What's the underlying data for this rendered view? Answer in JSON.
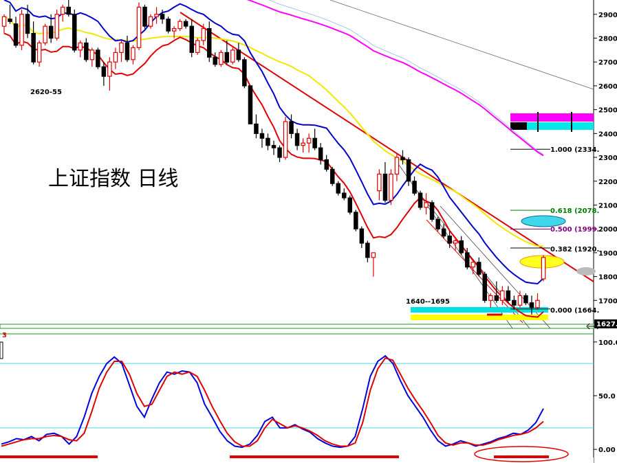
{
  "chart_data": [
    {
      "type": "candlestick",
      "title": "上证指数  日线",
      "ylim": [
        1600,
        2960
      ],
      "y_ticks": [
        "2900.-",
        "2800.-",
        "2700.-",
        "2600.-",
        "2500.-",
        "2400.-",
        "2300.-",
        "2200.-",
        "2100.-",
        "2000.-",
        "1900.-",
        "1800.-",
        "1700.-"
      ],
      "y_tick_values": [
        2900,
        2800,
        2700,
        2600,
        2500,
        2400,
        2300,
        2200,
        2100,
        2000,
        1900,
        1800,
        1700
      ],
      "last_price_label": "1627.",
      "annotations": {
        "high_label": "2620-55",
        "low_label": "1640--1695"
      },
      "fibonacci": [
        {
          "label": "1.000 (2334.",
          "value": 2334,
          "color": "#000000"
        },
        {
          "label": "0.618 (2078.",
          "value": 2078,
          "color": "#007a00"
        },
        {
          "label": "0.500 (1999.",
          "value": 1999,
          "color": "#800080"
        },
        {
          "label": "0.382 (1920.",
          "value": 1920,
          "color": "#000000"
        },
        {
          "label": "0.000 (1664.",
          "value": 1664,
          "color": "#000000"
        }
      ],
      "colors": {
        "up": "#e00000",
        "down": "#000000",
        "ma_blue": "#0000cc",
        "ma_red": "#e00000",
        "ma_yellow": "#f0e800",
        "ma_magenta": "#ff00ff",
        "ma_lightblue": "#8fb8ee",
        "trend": "#e00000",
        "zone_cyan": "#00e0e0",
        "zone_yellow": "#ffff00"
      },
      "candles": [
        [
          2850,
          2900,
          2820,
          2890
        ],
        [
          2880,
          2940,
          2860,
          2870
        ],
        [
          2860,
          2890,
          2760,
          2770
        ],
        [
          2770,
          2920,
          2750,
          2900
        ],
        [
          2900,
          2940,
          2800,
          2820
        ],
        [
          2820,
          2870,
          2690,
          2700
        ],
        [
          2700,
          2790,
          2680,
          2780
        ],
        [
          2780,
          2860,
          2770,
          2850
        ],
        [
          2850,
          2900,
          2780,
          2800
        ],
        [
          2800,
          2920,
          2790,
          2900
        ],
        [
          2900,
          2940,
          2870,
          2930
        ],
        [
          2930,
          2960,
          2890,
          2900
        ],
        [
          2900,
          2920,
          2740,
          2750
        ],
        [
          2750,
          2790,
          2720,
          2780
        ],
        [
          2780,
          2800,
          2700,
          2710
        ],
        [
          2710,
          2760,
          2680,
          2750
        ],
        [
          2750,
          2760,
          2670,
          2680
        ],
        [
          2680,
          2700,
          2600,
          2640
        ],
        [
          2640,
          2720,
          2580,
          2700
        ],
        [
          2700,
          2760,
          2670,
          2740
        ],
        [
          2740,
          2790,
          2700,
          2780
        ],
        [
          2780,
          2810,
          2700,
          2710
        ],
        [
          2710,
          2770,
          2690,
          2760
        ],
        [
          2760,
          2950,
          2750,
          2930
        ],
        [
          2930,
          2940,
          2840,
          2850
        ],
        [
          2850,
          2900,
          2840,
          2890
        ],
        [
          2890,
          2930,
          2860,
          2900
        ],
        [
          2900,
          2920,
          2860,
          2880
        ],
        [
          2880,
          2890,
          2820,
          2830
        ],
        [
          2830,
          2850,
          2800,
          2840
        ],
        [
          2840,
          2880,
          2830,
          2870
        ],
        [
          2870,
          2880,
          2840,
          2850
        ],
        [
          2850,
          2880,
          2720,
          2740
        ],
        [
          2740,
          2800,
          2730,
          2790
        ],
        [
          2790,
          2860,
          2770,
          2840
        ],
        [
          2840,
          2870,
          2700,
          2720
        ],
        [
          2720,
          2740,
          2680,
          2690
        ],
        [
          2690,
          2750,
          2680,
          2740
        ],
        [
          2740,
          2790,
          2690,
          2700
        ],
        [
          2700,
          2760,
          2690,
          2750
        ],
        [
          2750,
          2780,
          2700,
          2710
        ],
        [
          2710,
          2720,
          2590,
          2600
        ],
        [
          2600,
          2600,
          2440,
          2440
        ],
        [
          2440,
          2480,
          2380,
          2400
        ],
        [
          2400,
          2420,
          2340,
          2380
        ],
        [
          2380,
          2400,
          2330,
          2350
        ],
        [
          2350,
          2370,
          2310,
          2340
        ],
        [
          2340,
          2350,
          2280,
          2300
        ],
        [
          2300,
          2470,
          2290,
          2450
        ],
        [
          2450,
          2480,
          2380,
          2400
        ],
        [
          2400,
          2420,
          2330,
          2350
        ],
        [
          2350,
          2380,
          2320,
          2360
        ],
        [
          2360,
          2400,
          2320,
          2380
        ],
        [
          2380,
          2420,
          2330,
          2340
        ],
        [
          2340,
          2360,
          2270,
          2290
        ],
        [
          2290,
          2310,
          2240,
          2250
        ],
        [
          2250,
          2260,
          2180,
          2190
        ],
        [
          2190,
          2200,
          2140,
          2150
        ],
        [
          2150,
          2170,
          2120,
          2130
        ],
        [
          2130,
          2140,
          2060,
          2070
        ],
        [
          2070,
          2080,
          1990,
          2000
        ],
        [
          2000,
          2010,
          1920,
          1940
        ],
        [
          1940,
          1950,
          1860,
          1880
        ],
        [
          1880,
          1900,
          1800,
          1900
        ],
        [
          2160,
          2250,
          2120,
          2230
        ],
        [
          2230,
          2280,
          2110,
          2120
        ],
        [
          2120,
          2250,
          2100,
          2230
        ],
        [
          2230,
          2320,
          2200,
          2300
        ],
        [
          2300,
          2330,
          2270,
          2290
        ],
        [
          2290,
          2300,
          2180,
          2200
        ],
        [
          2200,
          2220,
          2140,
          2150
        ],
        [
          2150,
          2160,
          2080,
          2090
        ],
        [
          2090,
          2150,
          2060,
          2110
        ],
        [
          2110,
          2120,
          2030,
          2040
        ],
        [
          2040,
          2050,
          1990,
          2000
        ],
        [
          2000,
          2020,
          1960,
          1970
        ],
        [
          1970,
          1990,
          1920,
          1940
        ],
        [
          1940,
          1960,
          1910,
          1950
        ],
        [
          1950,
          1970,
          1890,
          1900
        ],
        [
          1900,
          1920,
          1830,
          1840
        ],
        [
          1840,
          1870,
          1810,
          1860
        ],
        [
          1860,
          1880,
          1800,
          1810
        ],
        [
          1810,
          1820,
          1690,
          1700
        ],
        [
          1700,
          1730,
          1670,
          1720
        ],
        [
          1720,
          1780,
          1690,
          1700
        ],
        [
          1700,
          1760,
          1680,
          1740
        ],
        [
          1740,
          1760,
          1690,
          1700
        ],
        [
          1700,
          1720,
          1660,
          1680
        ],
        [
          1680,
          1740,
          1670,
          1720
        ],
        [
          1720,
          1730,
          1680,
          1690
        ],
        [
          1690,
          1720,
          1640,
          1670
        ],
        [
          1670,
          1730,
          1660,
          1700
        ],
        [
          1790,
          1890,
          1780,
          1880
        ]
      ]
    },
    {
      "type": "line",
      "title": "",
      "ylim": [
        -5,
        105
      ],
      "y_ticks": [
        "100.0",
        "50.0",
        "0.00"
      ],
      "y_tick_values": [
        100,
        50,
        0
      ],
      "reference_lines": [
        80,
        20
      ],
      "series": [
        {
          "color": "#0000dd",
          "values": [
            5,
            7,
            10,
            9,
            12,
            8,
            14,
            15,
            12,
            5,
            12,
            30,
            52,
            68,
            80,
            86,
            80,
            60,
            40,
            30,
            47,
            62,
            72,
            70,
            73,
            72,
            62,
            42,
            30,
            17,
            8,
            3,
            2,
            5,
            13,
            26,
            30,
            20,
            20,
            23,
            19,
            16,
            10,
            6,
            3,
            2,
            3,
            12,
            38,
            68,
            82,
            87,
            80,
            64,
            50,
            40,
            30,
            18,
            8,
            3,
            5,
            8,
            6,
            3,
            5,
            7,
            10,
            12,
            15,
            14,
            18,
            25,
            38
          ]
        },
        {
          "color": "#e00000",
          "values": [
            3,
            5,
            7,
            9,
            10,
            10,
            12,
            13,
            12,
            9,
            8,
            15,
            35,
            57,
            72,
            82,
            82,
            70,
            52,
            40,
            42,
            55,
            68,
            72,
            70,
            72,
            68,
            55,
            40,
            27,
            15,
            7,
            3,
            3,
            8,
            20,
            28,
            24,
            20,
            22,
            20,
            17,
            13,
            8,
            5,
            3,
            3,
            6,
            25,
            55,
            75,
            85,
            83,
            70,
            57,
            46,
            36,
            25,
            13,
            6,
            4,
            6,
            6,
            4,
            4,
            6,
            9,
            11,
            13,
            14,
            16,
            20,
            26
          ]
        }
      ]
    }
  ]
}
